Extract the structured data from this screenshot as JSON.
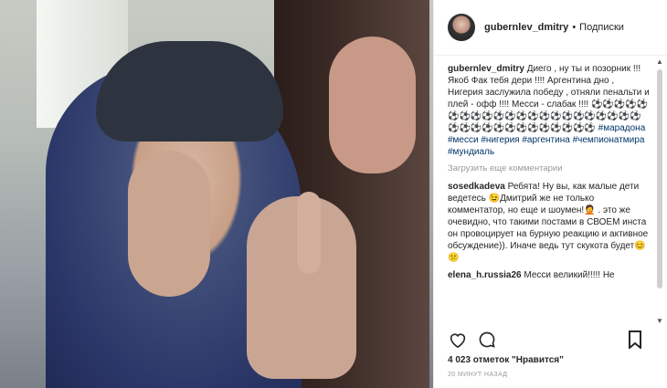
{
  "post": {
    "username": "gubernlev_dmitry",
    "separator": "•",
    "follow_label": "Подписки"
  },
  "caption": {
    "username": "gubernlev_dmitry",
    "text": "Диего , ну ты и позорник !!! Якоб Фак тебя дери !!!! Аргентина дно , Нигерия заслужила победу , отняли пенальти и плей - офф !!!! Месси - слабак !!!! ⚽⚽⚽⚽⚽⚽⚽⚽⚽⚽⚽⚽⚽⚽⚽⚽⚽⚽⚽⚽⚽⚽⚽⚽⚽⚽⚽⚽⚽⚽⚽⚽⚽⚽⚽ ",
    "hashtags": "#марадона #месси #нигерия #аргентина #чемпионатмира #мундиаль"
  },
  "load_more": "Загрузить еще комментарии",
  "comments": [
    {
      "username": "sosedkadeva",
      "text": "Ребята! Ну вы, как малые дети ведетесь 😉Дмитрий же не только комментатор, но еще и шоумен!🤦 . это же очевидно, что такими постами в СВОЕМ инста он провоцирует на бурную реакцию и активное обсуждение)). Иначе ведь тут скукота будет😊😕"
    },
    {
      "username": "elena_h.russia26",
      "text": "Месси великий!!!!! Не"
    }
  ],
  "likes": "4 023 отметок \"Нравится\"",
  "timestamp": "20 МИНУТ НАЗАД",
  "icons": {
    "like": "heart-icon",
    "comment": "comment-icon",
    "save": "bookmark-icon"
  },
  "colors": {
    "hashtag": "#003569",
    "text": "#262626",
    "muted": "#999999"
  }
}
